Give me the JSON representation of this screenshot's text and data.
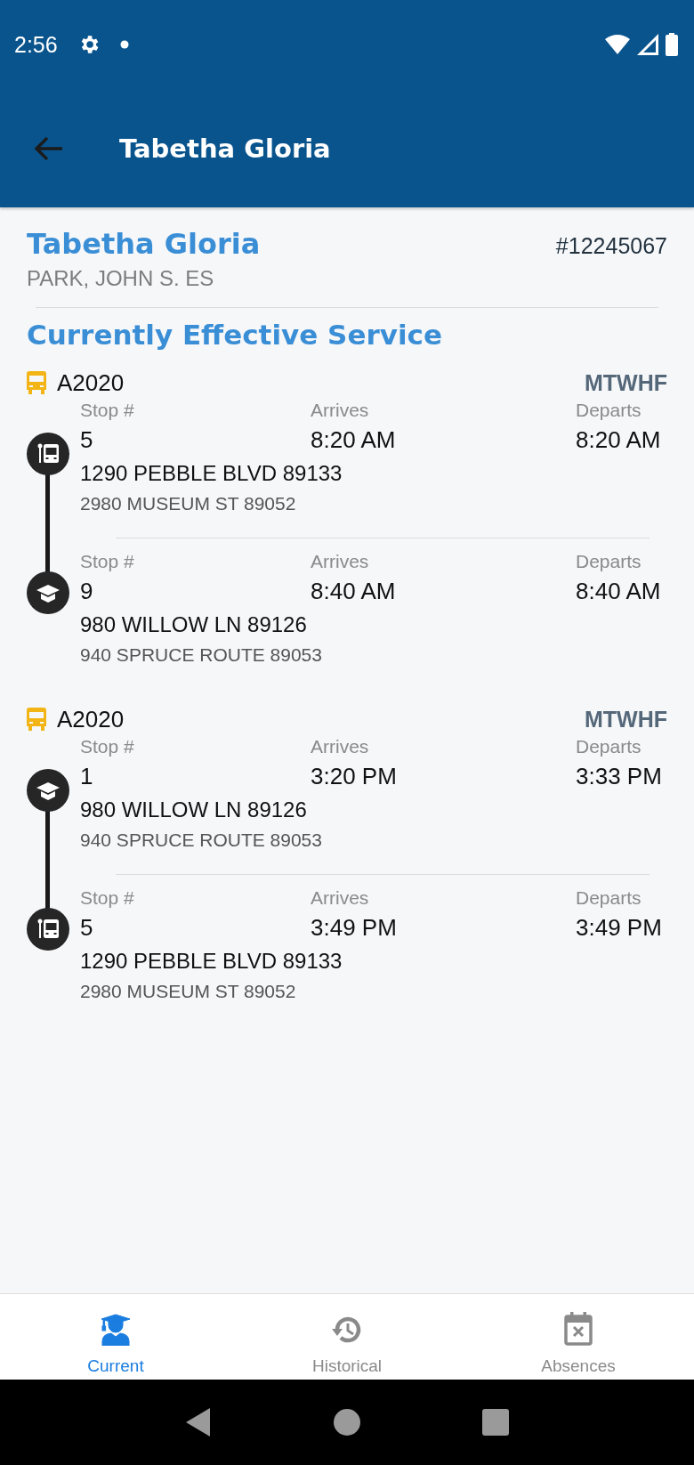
{
  "status_bar": {
    "time": "2:56"
  },
  "app_bar": {
    "title": "Tabetha Gloria"
  },
  "student": {
    "name": "Tabetha Gloria",
    "id": "#12245067",
    "school": "PARK, JOHN S. ES"
  },
  "section_title": "Currently Effective Service",
  "routes": [
    {
      "bus": "A2020",
      "days": "MTWHF",
      "stops": [
        {
          "kind": "bus-stop",
          "stop_label": "Stop #",
          "stop": "5",
          "arrives_label": "Arrives",
          "arrives": "8:20 AM",
          "departs_label": "Departs",
          "departs": "8:20 AM",
          "address": "1290 PEBBLE BLVD 89133",
          "address_2": "2980 MUSEUM ST 89052"
        },
        {
          "kind": "school",
          "stop_label": "Stop #",
          "stop": "9",
          "arrives_label": "Arrives",
          "arrives": "8:40 AM",
          "departs_label": "Departs",
          "departs": "8:40 AM",
          "address": "980 WILLOW LN 89126",
          "address_2": "940 SPRUCE ROUTE 89053"
        }
      ]
    },
    {
      "bus": "A2020",
      "days": "MTWHF",
      "stops": [
        {
          "kind": "school",
          "stop_label": "Stop #",
          "stop": "1",
          "arrives_label": "Arrives",
          "arrives": "3:20 PM",
          "departs_label": "Departs",
          "departs": "3:33 PM",
          "address": "980 WILLOW LN 89126",
          "address_2": "940 SPRUCE ROUTE 89053"
        },
        {
          "kind": "bus-stop",
          "stop_label": "Stop #",
          "stop": "5",
          "arrives_label": "Arrives",
          "arrives": "3:49 PM",
          "departs_label": "Departs",
          "departs": "3:49 PM",
          "address": "1290 PEBBLE BLVD 89133",
          "address_2": "2980 MUSEUM ST 89052"
        }
      ]
    }
  ],
  "tabs": [
    {
      "label": "Current",
      "kind": "current",
      "selected": true
    },
    {
      "label": "Historical",
      "kind": "history",
      "selected": false
    },
    {
      "label": "Absences",
      "kind": "absences",
      "selected": false
    }
  ]
}
